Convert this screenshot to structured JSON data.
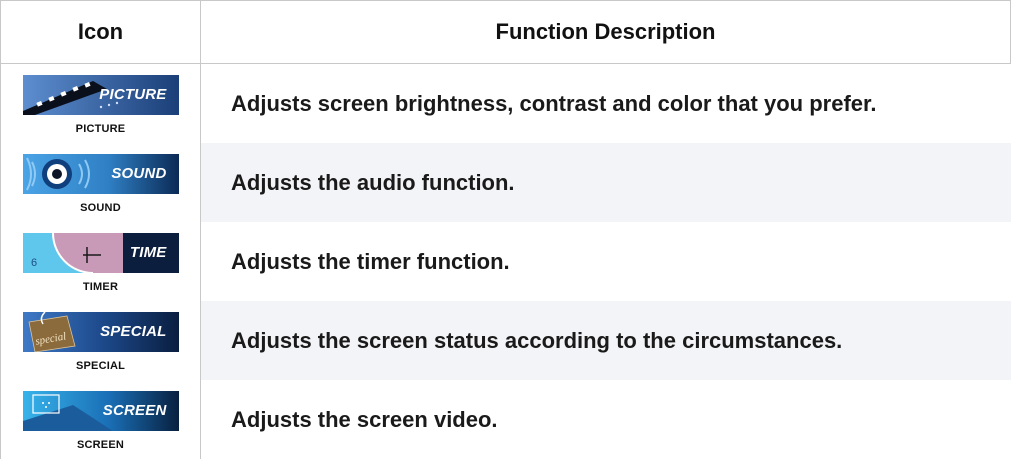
{
  "header": {
    "icon_col": "Icon",
    "desc_col": "Function Description"
  },
  "rows": [
    {
      "tile_word": "PICTURE",
      "caption": "PICTURE",
      "icon": "picture-icon",
      "description": "Adjusts screen brightness, contrast and color  that you prefer."
    },
    {
      "tile_word": "SOUND",
      "caption": "SOUND",
      "icon": "sound-icon",
      "description": "Adjusts the audio function."
    },
    {
      "tile_word": "TIME",
      "caption": "TIMER",
      "icon": "timer-icon",
      "description": "Adjusts the timer function."
    },
    {
      "tile_word": "SPECIAL",
      "caption": "SPECIAL",
      "icon": "special-icon",
      "description": "Adjusts the screen status according to the circumstances."
    },
    {
      "tile_word": "SCREEN",
      "caption": "SCREEN",
      "icon": "screen-icon",
      "description": "Adjusts the screen video."
    }
  ],
  "tile_art_texts": {
    "timer_digit": "6",
    "special_word": "special"
  }
}
